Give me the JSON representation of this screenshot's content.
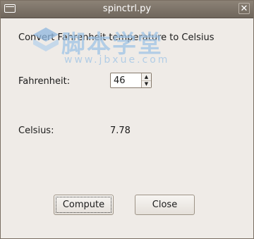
{
  "window": {
    "title": "spinctrl.py",
    "close_glyph": "✕"
  },
  "form": {
    "heading": "Convert Fahrenheit temperature to Celsius",
    "fahrenheit_label": "Fahrenheit:",
    "fahrenheit_value": "46",
    "celsius_label": "Celsius:",
    "celsius_value": "7.78"
  },
  "buttons": {
    "compute": "Compute",
    "close": "Close"
  },
  "watermark": {
    "text": "脚本学堂",
    "sub": "www.jbxue.com"
  }
}
